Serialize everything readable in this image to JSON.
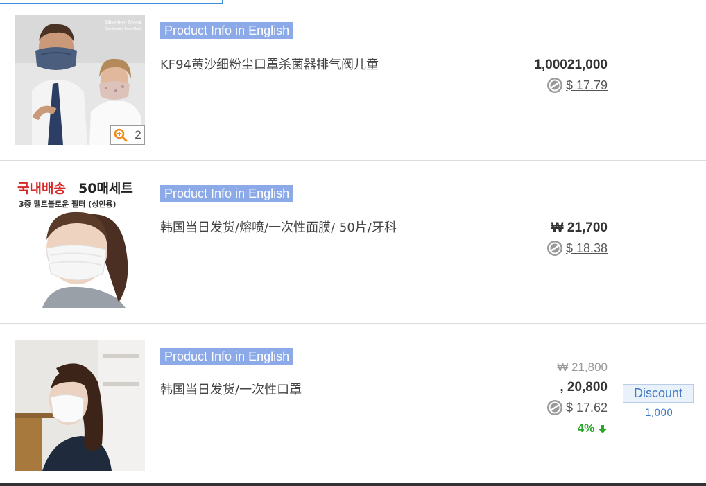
{
  "items": [
    {
      "info_label": "Product Info in English",
      "title": "KF94黄沙细粉尘口罩杀菌器排气阀儿童",
      "price": "1,00021,000",
      "usd": "$ 17.79",
      "zoom_count": "2",
      "image_brand_text": "Maelhan Mask",
      "image_brand_sub": "Comfortable Face Mask"
    },
    {
      "info_label": "Product Info in English",
      "title": "韩国当日发货/熔喷/一次性面膜/ 50片/牙科",
      "price": "₩ 21,700",
      "usd": "$ 18.38",
      "image_headline_red": "국내배송",
      "image_headline_black": "50매세트",
      "image_subline": "3중 멜트블로운 필터 (성인용)"
    },
    {
      "info_label": "Product Info in English",
      "title": "韩国当日发货/一次性口罩",
      "old_price": "₩ 21,800",
      "price": ", 20,800",
      "usd": "$ 17.62",
      "drop_percent": "4%",
      "discount_label": "Discount",
      "discount_amount": "1,000"
    }
  ],
  "colors": {
    "info_tag_bg": "#8ca9e8",
    "drop_green": "#2aa62a",
    "discount_blue": "#3e78c4",
    "zoom_orange": "#f08a1c"
  },
  "icons": {
    "zoom": "magnifier-plus-icon",
    "currency": "currency-exchange-icon",
    "drop": "arrow-down-icon"
  }
}
